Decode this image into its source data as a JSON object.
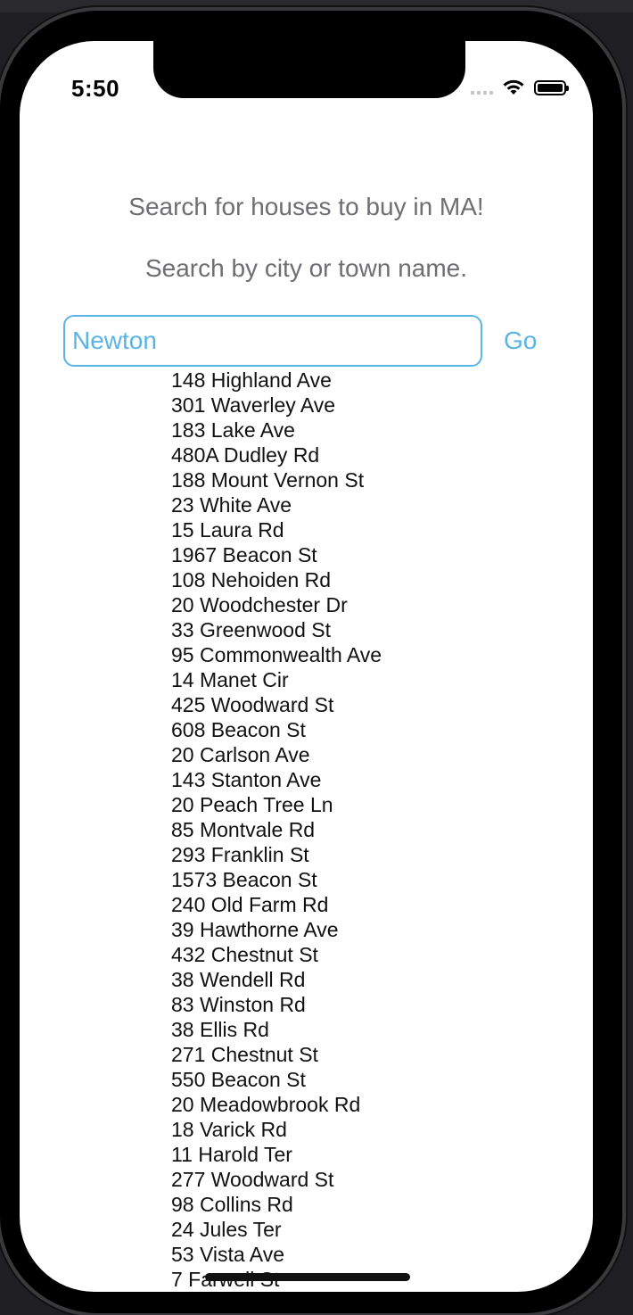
{
  "status_bar": {
    "time": "5:50",
    "icons": [
      "cellular-signal-icon",
      "wifi-icon",
      "battery-icon"
    ]
  },
  "header": {
    "title": "Search for houses to buy in MA!",
    "subtitle": "Search by city or town name."
  },
  "search": {
    "value": "Newton",
    "go_label": "Go"
  },
  "results": [
    "148 Highland Ave",
    "301 Waverley Ave",
    "183 Lake Ave",
    "480A Dudley Rd",
    "188 Mount Vernon St",
    "23 White Ave",
    "15 Laura Rd",
    "1967 Beacon St",
    "108 Nehoiden Rd",
    "20 Woodchester Dr",
    "33 Greenwood St",
    "95 Commonwealth Ave",
    "14 Manet Cir",
    "425 Woodward St",
    "608 Beacon St",
    "20 Carlson Ave",
    "143 Stanton Ave",
    "20 Peach Tree Ln",
    "85 Montvale Rd",
    "293 Franklin St",
    "1573 Beacon St",
    "240 Old Farm Rd",
    "39 Hawthorne Ave",
    "432 Chestnut St",
    "38 Wendell Rd",
    "83 Winston Rd",
    "38 Ellis Rd",
    "271 Chestnut St",
    "550 Beacon St",
    "20 Meadowbrook Rd",
    "18 Varick Rd",
    "11 Harold Ter",
    "277 Woodward St",
    "98 Collins Rd",
    "24 Jules Ter",
    "53 Vista Ave",
    "7 Farwell St"
  ],
  "colors": {
    "accent": "#5ab4e6",
    "heading_text": "#6e6e73",
    "body_text": "#111111"
  }
}
